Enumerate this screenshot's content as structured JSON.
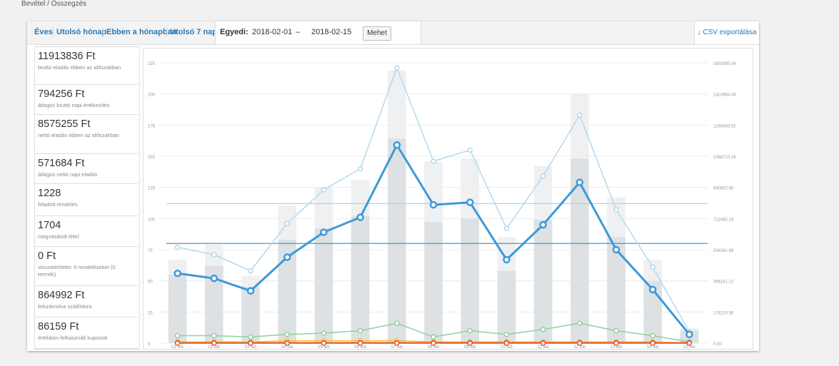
{
  "breadcrumb": "Bevétel / Összegzés",
  "tabs": [
    "Éves",
    "Utolsó hónap",
    "Ebben a hónapban",
    "Utolsó 7 nap"
  ],
  "custom_label": "Egyedi:",
  "date_from": "2018-02-01",
  "date_sep": "–",
  "date_to": "2018-02-15",
  "go_label": "Mehet",
  "csv_label": "CSV exportálása",
  "stats": [
    {
      "value": "11913836 Ft",
      "desc": "bruttó eladás ebben az időszakban",
      "color": "#aad4ee"
    },
    {
      "value": "794256 Ft",
      "desc": "átlagos bruttó napi értékesítés",
      "color": "#aad4ee"
    },
    {
      "value": "8575255 Ft",
      "desc": "nettó eladás ebben az időszakban",
      "color": "#3b99d9"
    },
    {
      "value": "571684 Ft",
      "desc": "átlagos nettó napi eladás",
      "color": "#3b99d9"
    },
    {
      "value": "1228",
      "desc": "feladott rendelés",
      "color": "#dcdcdc"
    },
    {
      "value": "1704",
      "desc": "megvásárolt tétel",
      "color": "#ececec"
    },
    {
      "value": "0 Ft",
      "desc": "visszatérítette: 0 rendeléseket (0 termék)",
      "color": "#e74c3c"
    },
    {
      "value": "864992 Ft",
      "desc": "felszámolva szállításra",
      "color": "#5fbf7f"
    },
    {
      "value": "86159 Ft",
      "desc": "értékben felhasznált kuponok",
      "color": "#f1c232"
    }
  ],
  "chart_data": {
    "type": "bar",
    "categories": [
      "01 feb",
      "02 feb",
      "03 feb",
      "04 feb",
      "05 feb",
      "06 feb",
      "07 feb",
      "08 feb",
      "09 feb",
      "10 feb",
      "11 feb",
      "12 feb",
      "13 feb",
      "14 feb",
      "15 feb"
    ],
    "left_ylim": [
      0,
      225
    ],
    "left_ticks": [
      "0",
      "25",
      "50",
      "75",
      "100",
      "125",
      "150",
      "175",
      "200",
      "225"
    ],
    "right_ylim": [
      0,
      1603085.04
    ],
    "right_ticks": [
      "0.00",
      "178120.56",
      "356241.12",
      "534361.68",
      "712482.24",
      "890602.80",
      "1068723.36",
      "1246843.92",
      "1424964.48",
      "1603085.04"
    ],
    "grid": true,
    "series": [
      {
        "kind": "bar",
        "color": "#eef0f1",
        "values": [
          67,
          79,
          54,
          110,
          125,
          131,
          219,
          146,
          148,
          85,
          142,
          200,
          117,
          67,
          12
        ]
      },
      {
        "kind": "bar",
        "color": "#dde1e3",
        "values": [
          55,
          62,
          45,
          83,
          92,
          102,
          164,
          97,
          100,
          58,
          99,
          148,
          85,
          50,
          10
        ]
      },
      {
        "kind": "line",
        "color": "#b3d9f0",
        "width": 1.5,
        "values": [
          77,
          71,
          58,
          96,
          123,
          140,
          221,
          146,
          155,
          92,
          134,
          183,
          107,
          61,
          9
        ]
      },
      {
        "kind": "line",
        "color": "#3b99d9",
        "width": 3,
        "values": [
          56,
          52,
          42,
          69,
          89,
          101,
          159,
          111,
          113,
          67,
          95,
          129,
          75,
          43,
          7
        ]
      },
      {
        "kind": "line",
        "color": "#8fd19e",
        "width": 1.5,
        "values": [
          6,
          6,
          5,
          7,
          8,
          10,
          16,
          5,
          10,
          7,
          11,
          16,
          10,
          6,
          1
        ]
      },
      {
        "kind": "line",
        "color": "#f1c232",
        "width": 1.5,
        "values": [
          1,
          1,
          1,
          2,
          2,
          2,
          2,
          1,
          1,
          1,
          1,
          1,
          1,
          1,
          0
        ]
      },
      {
        "kind": "line",
        "color": "#e67e22",
        "width": 1.5,
        "values": [
          0.5,
          0.5,
          0.5,
          0.5,
          0.5,
          0.5,
          0.5,
          0.5,
          0.5,
          0.5,
          0.5,
          0.5,
          0.5,
          0.5,
          0.5
        ]
      },
      {
        "kind": "line",
        "color": "#e74c3c",
        "width": 1.5,
        "values": [
          0,
          0,
          0,
          0,
          0,
          0,
          0,
          0,
          0,
          0,
          0,
          0,
          0,
          0,
          0
        ]
      }
    ],
    "average_lines": [
      {
        "color": "#aad4ee",
        "value": 112
      },
      {
        "color": "#3b99d9",
        "value": 80
      }
    ]
  }
}
